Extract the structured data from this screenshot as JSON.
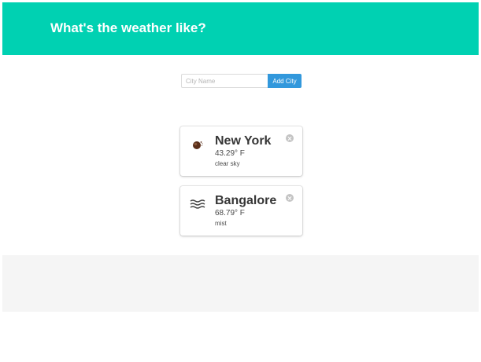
{
  "header": {
    "title": "What's the weather like?"
  },
  "form": {
    "input_placeholder": "City Name",
    "input_value": "",
    "add_button_label": "Add City"
  },
  "cities": [
    {
      "name": "New York",
      "temperature": "43.29° F",
      "description": "clear sky",
      "icon": "clear-sky-icon"
    },
    {
      "name": "Bangalore",
      "temperature": "68.79° F",
      "description": "mist",
      "icon": "mist-icon"
    }
  ],
  "colors": {
    "header": "#00d1b2",
    "button": "#3298dc",
    "footer": "#f5f5f5"
  }
}
